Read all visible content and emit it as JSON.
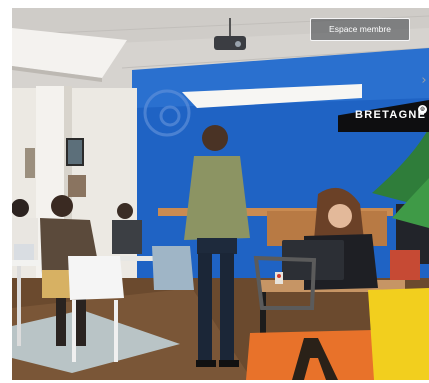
{
  "header": {
    "member_button_label": "Espace membre"
  },
  "banner": {
    "region_label": "BRETAGNE"
  },
  "colors": {
    "wall_blue": "#1f63c4",
    "ceiling": "#dcdad7",
    "floor": "#6b4a2e",
    "cushion_orange": "#e8722a",
    "cushion_yellow": "#f2cf1e",
    "banner_bg": "#0e0e10"
  },
  "icons": {
    "carousel_next": "chevron-right-icon",
    "brand_circle": "watermark-logo-icon"
  }
}
